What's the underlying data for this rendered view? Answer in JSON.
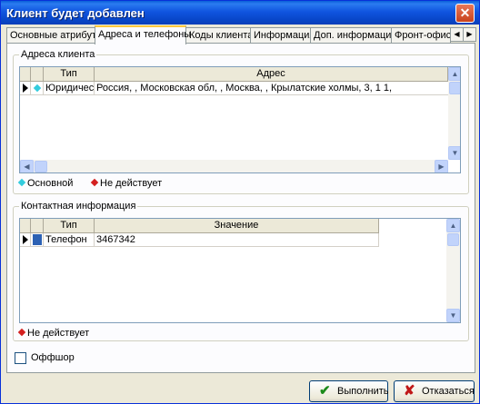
{
  "window": {
    "title": "Клиент будет добавлен",
    "close_label": "✕"
  },
  "tabs": [
    {
      "label": "Основные атрибуты"
    },
    {
      "label": "Адреса и телефоны"
    },
    {
      "label": "Коды клиента"
    },
    {
      "label": "Информация"
    },
    {
      "label": "Доп. информация"
    },
    {
      "label": "Фронт-офис"
    }
  ],
  "tab_scroll": {
    "left": "◀",
    "right": "▶"
  },
  "addresses": {
    "group_title": "Адреса клиента",
    "columns": {
      "type": "Тип",
      "address": "Адрес"
    },
    "rows": [
      {
        "type": "Юридический",
        "address": "Россия, , Московская обл, , Москва, , Крылатские холмы, 3, 1 1,"
      }
    ],
    "legend": {
      "primary": "Основной",
      "inactive": "Не действует"
    }
  },
  "contacts": {
    "group_title": "Контактная информация",
    "columns": {
      "type": "Тип",
      "value": "Значение"
    },
    "rows": [
      {
        "type": "Телефон",
        "value": "3467342"
      }
    ],
    "legend": {
      "inactive": "Не действует"
    }
  },
  "offshore": {
    "label": "Оффшор",
    "checked": false
  },
  "buttons": {
    "execute": "Выполнить",
    "cancel": "Отказаться"
  },
  "icons": {
    "check": "✔",
    "cross": "✘",
    "up": "▲",
    "down": "▼",
    "left": "◀",
    "right": "▶"
  },
  "colors": {
    "primary_marker": "#33ccdd",
    "inactive_marker": "#d42020",
    "titlebar": "#0a5fd8"
  }
}
